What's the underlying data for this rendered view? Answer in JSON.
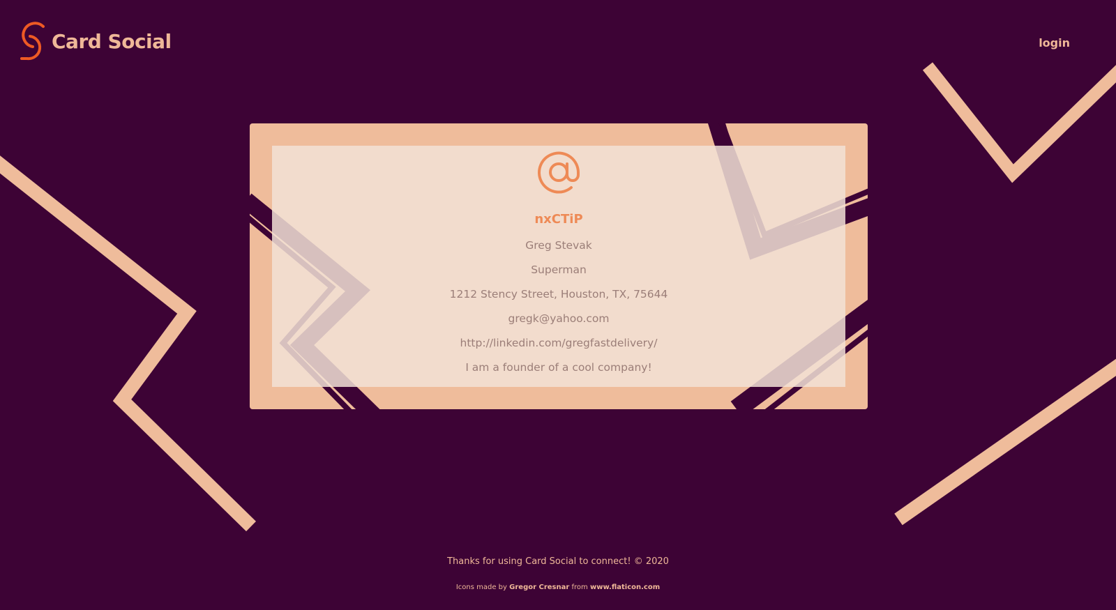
{
  "header": {
    "brand_name": "Card Social",
    "login_label": "login"
  },
  "card": {
    "icon": "at-sign-icon",
    "handle": "nxCTiP",
    "name": "Greg Stevak",
    "title": "Superman",
    "address": "1212 Stency Street, Houston, TX, 75644",
    "email": "gregk@yahoo.com",
    "website": "http://linkedin.com/gregfastdelivery/",
    "bio": "I am a founder of a cool company!"
  },
  "footer": {
    "thanks": "Thanks for using Card Social to connect! © 2020",
    "credit_prefix": "Icons made by",
    "credit_author": "Gregor Cresnar",
    "credit_from": "from",
    "credit_site": "www.flaticon.com"
  },
  "colors": {
    "background": "#3d0335",
    "accent": "#efbc9b",
    "brand_orange": "#ee8a56",
    "deco_purple": "#9c7a99",
    "text_muted": "#9b7e78"
  }
}
